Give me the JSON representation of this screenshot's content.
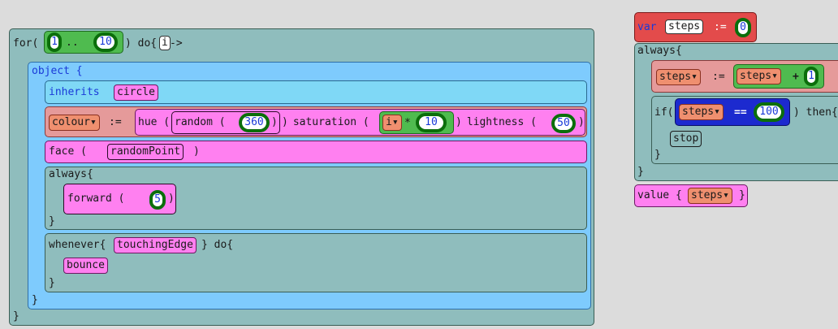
{
  "for_loop": {
    "keyword": "for(",
    "from": "1",
    "range_sep": "..",
    "to": "10",
    "close": ") do{",
    "var": "i",
    "arrow": "->",
    "end": "}"
  },
  "object_block": {
    "label": "object {",
    "end": "}",
    "inherits": {
      "keyword": "inherits",
      "value": "circle"
    },
    "colour": {
      "target": "colour",
      "assign": ":=",
      "hue": "hue (",
      "random": "random (",
      "random_arg": "360",
      "random_close": ")",
      "hue_close": ")",
      "saturation": " saturation (",
      "var": "i",
      "times": "*",
      "factor": "10",
      "sat_close": ")",
      "lightness": " lightness (",
      "lightness_val": "50",
      "light_close": ")"
    },
    "face": {
      "keyword": "face (",
      "value": "randomPoint",
      "close": ")"
    },
    "always": {
      "label": "always{",
      "end": "}",
      "forward": {
        "keyword": "forward (",
        "value": "5",
        "close": ")"
      }
    },
    "whenever": {
      "label": "whenever{",
      "condition": "touchingEdge",
      "do": "} do{",
      "action": "bounce",
      "end": "}"
    }
  },
  "var_decl": {
    "keyword": "var",
    "name": "steps",
    "assign": ":=",
    "value": "0"
  },
  "right_always": {
    "label": "always{",
    "end": "}",
    "assign": {
      "target": "steps",
      "op": ":=",
      "source": "steps",
      "plus": "+",
      "amount": "1"
    },
    "if_block": {
      "keyword": "if(",
      "var": "steps",
      "cmp": "==",
      "value": "100",
      "then": ") then{",
      "action": "stop",
      "end": "}"
    }
  },
  "value_block": {
    "keyword": "value {",
    "var": "steps",
    "end": "}"
  },
  "colors": {
    "teal": "#8fbdbd",
    "blue": "#7ecbfd",
    "pink": "#ff80f0",
    "salmon": "#e59a9a",
    "red": "#e34b4b",
    "green": "#4fbb4f",
    "darkblue": "#1c2acf"
  }
}
